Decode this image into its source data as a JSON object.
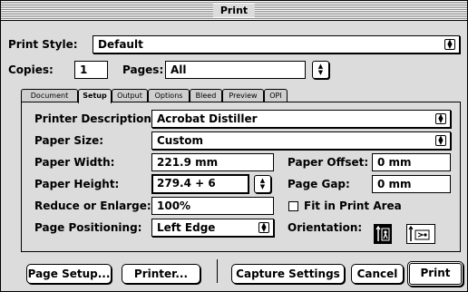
{
  "window": {
    "title": "Print"
  },
  "header": {
    "print_style_label": "Print Style:",
    "print_style_value": "Default",
    "copies_label": "Copies:",
    "copies_value": "1",
    "pages_label": "Pages:",
    "pages_value": "All"
  },
  "tabs": [
    {
      "label": "Document"
    },
    {
      "label": "Setup"
    },
    {
      "label": "Output"
    },
    {
      "label": "Options"
    },
    {
      "label": "Bleed"
    },
    {
      "label": "Preview"
    },
    {
      "label": "OPI"
    }
  ],
  "active_tab": "Setup",
  "setup": {
    "printer_description_label": "Printer Description:",
    "printer_description_value": "Acrobat Distiller",
    "paper_size_label": "Paper Size:",
    "paper_size_value": "Custom",
    "paper_width_label": "Paper Width:",
    "paper_width_value": "221.9  mm",
    "paper_offset_label": "Paper Offset:",
    "paper_offset_value": "0 mm",
    "paper_height_label": "Paper Height:",
    "paper_height_value": "279.4 + 6",
    "page_gap_label": "Page Gap:",
    "page_gap_value": "0 mm",
    "reduce_label": "Reduce or Enlarge:",
    "reduce_value": "100%",
    "fit_label": "Fit in Print Area",
    "fit_checked": false,
    "positioning_label": "Page Positioning:",
    "positioning_value": "Left Edge",
    "orientation_label": "Orientation:",
    "orientation_selected": "portrait"
  },
  "footer": {
    "page_setup": "Page Setup...",
    "printer": "Printer...",
    "capture_settings": "Capture Settings",
    "cancel": "Cancel",
    "print": "Print"
  },
  "icons": {
    "popup_arrows": "⬍",
    "stepper_arrows": "⬍"
  }
}
